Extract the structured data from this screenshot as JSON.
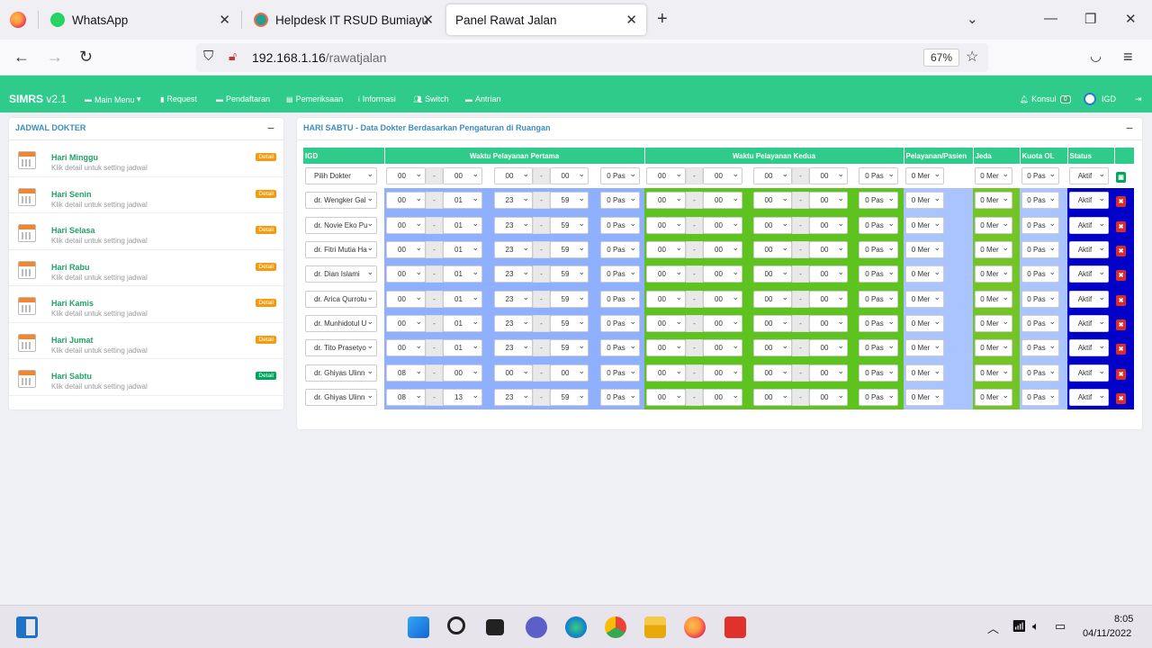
{
  "browser": {
    "tabs": [
      {
        "title": "WhatsApp",
        "icon": "whatsapp-icon"
      },
      {
        "title": "Helpdesk IT RSUD Bumiayu",
        "icon": "hospital-logo-icon"
      },
      {
        "title": "Panel Rawat Jalan",
        "icon": ""
      }
    ],
    "url_host": "192.168.1.16",
    "url_path": "/rawatjalan",
    "zoom": "67%"
  },
  "app": {
    "brand": "SIMRS",
    "version": "v2.1",
    "menu": [
      {
        "label": "Main Menu",
        "icon": "folder-icon",
        "caret": "▾"
      },
      {
        "label": "Request",
        "icon": "file-icon"
      },
      {
        "label": "Pendaftaran",
        "icon": "folder-icon"
      },
      {
        "label": "Pemeriksaan",
        "icon": "list-icon"
      },
      {
        "label": "Informasi",
        "icon": "info-icon"
      },
      {
        "label": "Switch",
        "icon": "users-icon"
      },
      {
        "label": "Antrian",
        "icon": "folder-icon"
      }
    ],
    "konsul_label": "Konsul",
    "konsul_count": "0",
    "user": "IGD"
  },
  "schedule_panel": {
    "title": "JADWAL DOKTER",
    "items": [
      {
        "day": "Hari Minggu",
        "sub": "Klik detail untuk setting jadwal",
        "badge": "Detail",
        "active": false
      },
      {
        "day": "Hari Senin",
        "sub": "Klik detail untuk setting jadwal",
        "badge": "Detail",
        "active": false
      },
      {
        "day": "Hari Selasa",
        "sub": "Klik detail untuk setting jadwal",
        "badge": "Detail",
        "active": false
      },
      {
        "day": "Hari Rabu",
        "sub": "Klik detail untuk setting jadwal",
        "badge": "Detail",
        "active": false
      },
      {
        "day": "Hari Kamis",
        "sub": "Klik detail untuk setting jadwal",
        "badge": "Detail",
        "active": false
      },
      {
        "day": "Hari Jumat",
        "sub": "Klik detail untuk setting jadwal",
        "badge": "Detail",
        "active": false
      },
      {
        "day": "Hari Sabtu",
        "sub": "Klik detail untuk setting jadwal",
        "badge": "Detail",
        "active": true
      }
    ]
  },
  "doctor_panel": {
    "title": "HARI SABTU - Data Dokter Berdasarkan Pengaturan di Ruangan",
    "headers": {
      "room": "IGD",
      "first": "Waktu Pelayanan Pertama",
      "second": "Waktu Pelayanan Kedua",
      "per_patient": "Pelayanan/Pasien",
      "break": "Jeda",
      "quota": "Kuota OL",
      "status": "Status"
    },
    "new_row": {
      "doctor": "Pilih Dokter",
      "s1": [
        "00",
        "00",
        "00",
        "00"
      ],
      "p1": "0 Pas",
      "s2": [
        "00",
        "00",
        "00",
        "00"
      ],
      "p2": "0 Pas",
      "per": "0 Mer",
      "jeda": "0 Mer",
      "kuota": "0 Pas",
      "status": "Aktif"
    },
    "rows": [
      {
        "doctor": "dr. Wengker Gal",
        "s1": [
          "00",
          "01",
          "23",
          "59"
        ],
        "p1": "0 Pas",
        "s2": [
          "00",
          "00",
          "00",
          "00"
        ],
        "p2": "0 Pas",
        "per": "0 Mer",
        "jeda": "0 Mer",
        "kuota": "0 Pas",
        "status": "Aktif"
      },
      {
        "doctor": "dr. Novie Eko Pu",
        "s1": [
          "00",
          "01",
          "23",
          "59"
        ],
        "p1": "0 Pas",
        "s2": [
          "00",
          "00",
          "00",
          "00"
        ],
        "p2": "0 Pas",
        "per": "0 Mer",
        "jeda": "0 Mer",
        "kuota": "0 Pas",
        "status": "Aktif"
      },
      {
        "doctor": "dr. Fitri Mutia Ha",
        "s1": [
          "00",
          "01",
          "23",
          "59"
        ],
        "p1": "0 Pas",
        "s2": [
          "00",
          "00",
          "00",
          "00"
        ],
        "p2": "0 Pas",
        "per": "0 Mer",
        "jeda": "0 Mer",
        "kuota": "0 Pas",
        "status": "Aktif"
      },
      {
        "doctor": "dr. Dian Islami",
        "s1": [
          "00",
          "01",
          "23",
          "59"
        ],
        "p1": "0 Pas",
        "s2": [
          "00",
          "00",
          "00",
          "00"
        ],
        "p2": "0 Pas",
        "per": "0 Mer",
        "jeda": "0 Mer",
        "kuota": "0 Pas",
        "status": "Aktif"
      },
      {
        "doctor": "dr. Arica Qurrotu",
        "s1": [
          "00",
          "01",
          "23",
          "59"
        ],
        "p1": "0 Pas",
        "s2": [
          "00",
          "00",
          "00",
          "00"
        ],
        "p2": "0 Pas",
        "per": "0 Mer",
        "jeda": "0 Mer",
        "kuota": "0 Pas",
        "status": "Aktif"
      },
      {
        "doctor": "dr. Munhidotul U",
        "s1": [
          "00",
          "01",
          "23",
          "59"
        ],
        "p1": "0 Pas",
        "s2": [
          "00",
          "00",
          "00",
          "00"
        ],
        "p2": "0 Pas",
        "per": "0 Mer",
        "jeda": "0 Mer",
        "kuota": "0 Pas",
        "status": "Aktif"
      },
      {
        "doctor": "dr. Tito Prasetyo",
        "s1": [
          "00",
          "01",
          "23",
          "59"
        ],
        "p1": "0 Pas",
        "s2": [
          "00",
          "00",
          "00",
          "00"
        ],
        "p2": "0 Pas",
        "per": "0 Mer",
        "jeda": "0 Mer",
        "kuota": "0 Pas",
        "status": "Aktif"
      },
      {
        "doctor": "dr. Ghiyas Ulinn",
        "s1": [
          "08",
          "00",
          "00",
          "00"
        ],
        "p1": "0 Pas",
        "s2": [
          "00",
          "00",
          "00",
          "00"
        ],
        "p2": "0 Pas",
        "per": "0 Mer",
        "jeda": "0 Mer",
        "kuota": "0 Pas",
        "status": "Aktif"
      },
      {
        "doctor": "dr. Ghiyas Ulinn",
        "s1": [
          "08",
          "13",
          "23",
          "59"
        ],
        "p1": "0 Pas",
        "s2": [
          "00",
          "00",
          "00",
          "00"
        ],
        "p2": "0 Pas",
        "per": "0 Mer",
        "jeda": "0 Mer",
        "kuota": "0 Pas",
        "status": "Aktif"
      }
    ],
    "dash": "-"
  },
  "taskbar": {
    "time": "8:05",
    "date": "04/11/2022"
  },
  "colors": {
    "accent": "#2fcb8b",
    "first_slot_bg": "#8fb0ff",
    "second_slot_bg": "#5fc31f",
    "status_bg": "#0000c8"
  }
}
